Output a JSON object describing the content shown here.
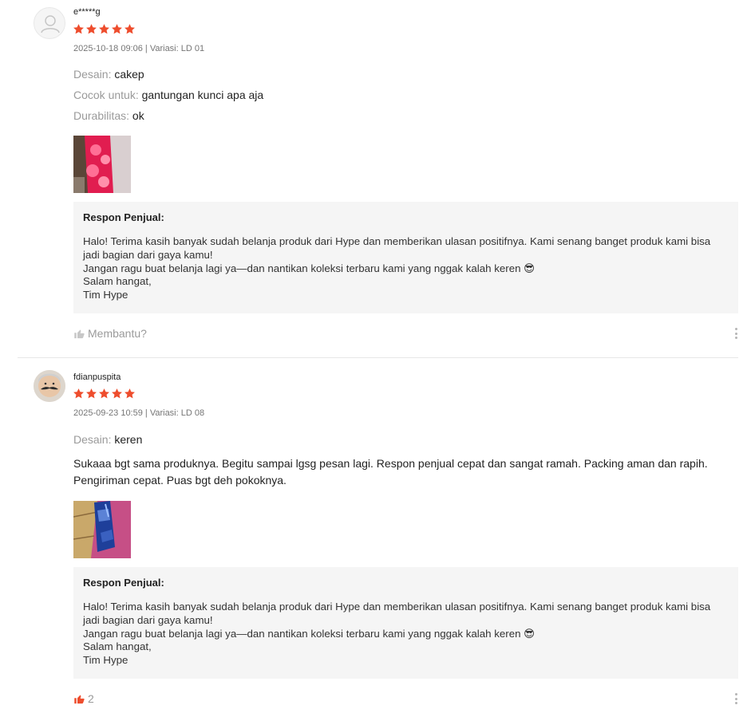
{
  "reviews": [
    {
      "username": "e*****g",
      "rating": 5,
      "meta": "2025-10-18 09:06 | Variasi: LD 01",
      "attributes": [
        {
          "label": "Desain:",
          "value": "cakep"
        },
        {
          "label": "Cocok untuk:",
          "value": "gantungan kunci apa aja"
        },
        {
          "label": "Durabilitas:",
          "value": "ok"
        }
      ],
      "reply_title": "Respon Penjual:",
      "reply_text": "Halo! Terima kasih banyak sudah belanja produk dari Hype dan memberikan ulasan positifnya. Kami senang banget produk kami bisa jadi bagian dari gaya kamu!\nJangan ragu buat belanja lagi ya—dan nantikan koleksi terbaru kami yang nggak kalah keren 😎\nSalam hangat,\nTim Hype",
      "helpful_label": "Membantu?"
    },
    {
      "username": "fdianpuspita",
      "rating": 5,
      "meta": "2025-09-23 10:59 | Variasi: LD 08",
      "attributes": [
        {
          "label": "Desain:",
          "value": "keren"
        }
      ],
      "comment": "Sukaaa bgt sama produknya. Begitu sampai lgsg pesan lagi. Respon penjual cepat dan sangat ramah. Packing aman dan rapih. Pengiriman cepat. Puas bgt deh pokoknya.",
      "reply_title": "Respon Penjual:",
      "reply_text": "Halo! Terima kasih banyak sudah belanja produk dari Hype dan memberikan ulasan positifnya. Kami senang banget produk kami bisa jadi bagian dari gaya kamu!\nJangan ragu buat belanja lagi ya—dan nantikan koleksi terbaru kami yang nggak kalah keren 😎\nSalam hangat,\nTim Hype",
      "helpful_count": "2"
    }
  ],
  "colors": {
    "star": "#ee4d2d",
    "like_active": "#ee4d2d",
    "reply_bg": "#f5f5f5"
  },
  "icons": [
    "user-placeholder-icon",
    "star-icon",
    "thumbs-up-icon",
    "more-vertical-icon"
  ]
}
